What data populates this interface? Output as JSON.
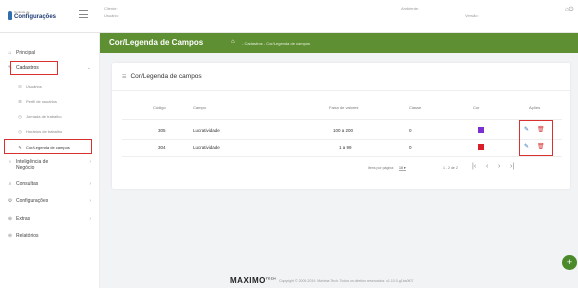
{
  "header": {
    "logo_small": "Controle de",
    "logo_big": "Configurações",
    "cliente_label": "Cliente:",
    "usuario_label": "Usuário:",
    "ambiente_label": "Ambiente:",
    "versao_label": "Versão:",
    "icons": [
      "home-icon",
      "power-icon"
    ]
  },
  "sidebar": {
    "items": [
      {
        "label": "Principal",
        "icon": "home-icon"
      },
      {
        "label": "Cadastros",
        "icon": "edit-icon"
      },
      {
        "label": "Usuários",
        "icon": "users-icon"
      },
      {
        "label": "Perfil de usuários",
        "icon": "list-icon"
      },
      {
        "label": "Jornada de trabalho",
        "icon": "clock-icon"
      },
      {
        "label": "Horários de trabalho",
        "icon": "clock-icon"
      },
      {
        "label": "Cor/Legenda de campos",
        "icon": "pencil-icon"
      },
      {
        "label": "Inteligência de Negócio",
        "icon": "bulb-icon"
      },
      {
        "label": "Consultas",
        "icon": "search-icon"
      },
      {
        "label": "Configurações",
        "icon": "gear-icon"
      },
      {
        "label": "Extras",
        "icon": "plus-circle-icon"
      },
      {
        "label": "Relatórios",
        "icon": "report-icon"
      }
    ]
  },
  "page": {
    "title": "Cor/Legenda de Campos",
    "breadcrumb": "- Cadastros - Cor/Legenda de campos"
  },
  "card": {
    "title": "Cor/Legenda de campos"
  },
  "table": {
    "headers": [
      "Código",
      "Campo",
      "Faixa de valores",
      "Classe",
      "Cor",
      "Ações"
    ],
    "rows": [
      {
        "codigo": "305",
        "campo": "Lucratividade",
        "faixa": "100 a 200",
        "classe": "0",
        "cor": "#7b2fd0"
      },
      {
        "codigo": "304",
        "campo": "Lucratividade",
        "faixa": "1 a 99",
        "classe": "0",
        "cor": "#d91e2a"
      }
    ]
  },
  "pagination": {
    "items_per_page_label": "Itens por página:",
    "items_per_page_value": "10",
    "range": "1 - 2 de 2"
  },
  "footer": {
    "brand": "MAXIMO",
    "brand_suffix": "TECH",
    "copyright": "Copyright © 2009-2019. Máxima Tech. Todos os direitos reservados. v1.10.0-g1ba0f07"
  },
  "colors": {
    "accent": "#5f8f33",
    "highlight": "#d93030"
  }
}
